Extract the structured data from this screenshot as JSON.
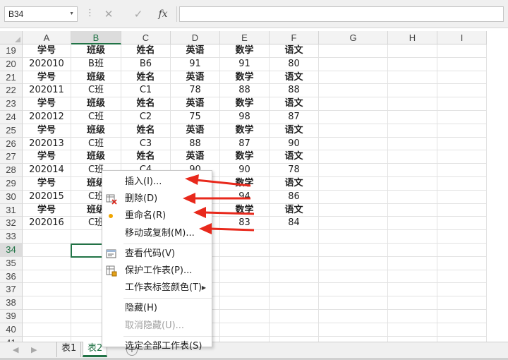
{
  "formula_bar": {
    "name_box": "B34",
    "cancel_icon": "✕",
    "enter_icon": "✓",
    "fx_icon": "fx",
    "formula": ""
  },
  "columns": [
    "A",
    "B",
    "C",
    "D",
    "E",
    "F",
    "G",
    "H",
    "I"
  ],
  "selected_column": "B",
  "rows": [
    {
      "num": "19",
      "cells": [
        "学号",
        "班级",
        "姓名",
        "英语",
        "数学",
        "语文"
      ],
      "header": true
    },
    {
      "num": "20",
      "cells": [
        "202010",
        "B班",
        "B6",
        "91",
        "91",
        "80"
      ],
      "header": false
    },
    {
      "num": "21",
      "cells": [
        "学号",
        "班级",
        "姓名",
        "英语",
        "数学",
        "语文"
      ],
      "header": true
    },
    {
      "num": "22",
      "cells": [
        "202011",
        "C班",
        "C1",
        "78",
        "88",
        "88"
      ],
      "header": false
    },
    {
      "num": "23",
      "cells": [
        "学号",
        "班级",
        "姓名",
        "英语",
        "数学",
        "语文"
      ],
      "header": true
    },
    {
      "num": "24",
      "cells": [
        "202012",
        "C班",
        "C2",
        "75",
        "98",
        "87"
      ],
      "header": false
    },
    {
      "num": "25",
      "cells": [
        "学号",
        "班级",
        "姓名",
        "英语",
        "数学",
        "语文"
      ],
      "header": true
    },
    {
      "num": "26",
      "cells": [
        "202013",
        "C班",
        "C3",
        "88",
        "87",
        "90"
      ],
      "header": false
    },
    {
      "num": "27",
      "cells": [
        "学号",
        "班级",
        "姓名",
        "英语",
        "数学",
        "语文"
      ],
      "header": true
    },
    {
      "num": "28",
      "cells": [
        "202014",
        "C班",
        "C4",
        "90",
        "90",
        "78"
      ],
      "header": false
    },
    {
      "num": "29",
      "cells": [
        "学号",
        "班级",
        "",
        "",
        "数学",
        "语文"
      ],
      "header": true
    },
    {
      "num": "30",
      "cells": [
        "202015",
        "C班",
        "",
        "",
        "94",
        "86"
      ],
      "header": false
    },
    {
      "num": "31",
      "cells": [
        "学号",
        "班级",
        "",
        "",
        "数学",
        "语文"
      ],
      "header": true
    },
    {
      "num": "32",
      "cells": [
        "202016",
        "C班",
        "",
        "",
        "83",
        "84"
      ],
      "header": false
    },
    {
      "num": "33",
      "cells": [
        "",
        "",
        "",
        "",
        "",
        ""
      ],
      "header": false
    },
    {
      "num": "34",
      "cells": [
        "",
        "",
        "",
        "",
        "",
        ""
      ],
      "header": false
    },
    {
      "num": "35",
      "cells": [
        "",
        "",
        "",
        "",
        "",
        ""
      ],
      "header": false
    },
    {
      "num": "36",
      "cells": [
        "",
        "",
        "",
        "",
        "",
        ""
      ],
      "header": false
    },
    {
      "num": "37",
      "cells": [
        "",
        "",
        "",
        "",
        "",
        ""
      ],
      "header": false
    },
    {
      "num": "38",
      "cells": [
        "",
        "",
        "",
        "",
        "",
        ""
      ],
      "header": false
    },
    {
      "num": "39",
      "cells": [
        "",
        "",
        "",
        "",
        "",
        ""
      ],
      "header": false
    },
    {
      "num": "40",
      "cells": [
        "",
        "",
        "",
        "",
        "",
        ""
      ],
      "header": false
    },
    {
      "num": "41",
      "cells": [
        "",
        "",
        "",
        "",
        "",
        ""
      ],
      "header": false
    }
  ],
  "selected_row": "34",
  "context_menu": {
    "items": [
      {
        "label": "插入(I)...",
        "icon": "",
        "disabled": false
      },
      {
        "label": "删除(D)",
        "icon": "delete-sheet-icon",
        "disabled": false
      },
      {
        "label": "重命名(R)",
        "icon": "rename-dot-icon",
        "disabled": false
      },
      {
        "label": "移动或复制(M)...",
        "icon": "",
        "disabled": false
      },
      {
        "label": "查看代码(V)",
        "icon": "view-code-icon",
        "disabled": false
      },
      {
        "label": "保护工作表(P)...",
        "icon": "protect-sheet-icon",
        "disabled": false
      },
      {
        "label": "工作表标签颜色(T)",
        "icon": "",
        "disabled": false,
        "submenu": true
      },
      {
        "label": "隐藏(H)",
        "icon": "",
        "disabled": false
      },
      {
        "label": "取消隐藏(U)...",
        "icon": "",
        "disabled": true
      },
      {
        "label": "选定全部工作表(S)",
        "icon": "",
        "disabled": false
      }
    ]
  },
  "sheet_tabs": {
    "tabs": [
      {
        "label": "表1",
        "active": false
      },
      {
        "label": "表2",
        "active": true
      }
    ],
    "add_label": "+"
  },
  "colors": {
    "accent_green": "#217346",
    "annotation_red": "#e8291c",
    "rename_dot": "#f0a500"
  }
}
